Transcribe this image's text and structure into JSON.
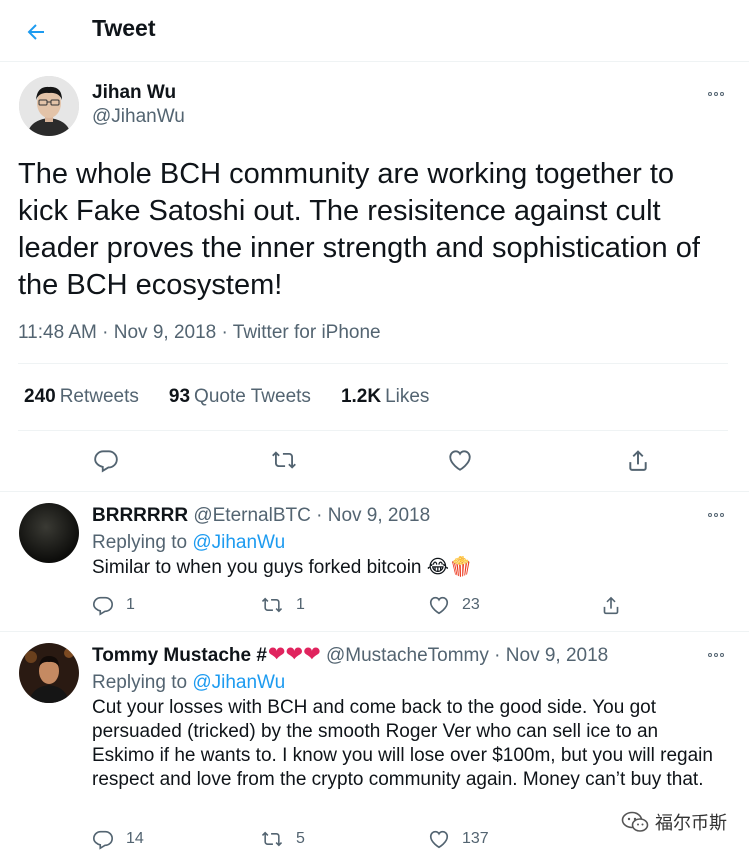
{
  "header": {
    "title": "Tweet"
  },
  "main_tweet": {
    "name": "Jihan Wu",
    "handle": "@JihanWu",
    "text": "The whole BCH community are working together to kick Fake Satoshi out. The resisitence against cult leader proves the inner strength and sophistication of the BCH ecosystem!",
    "time": "11:48 AM",
    "date": "Nov 9, 2018",
    "source": "Twitter for iPhone",
    "sep": "·",
    "retweets_count": "240",
    "retweets_label": "Retweets",
    "quotes_count": "93",
    "quotes_label": "Quote Tweets",
    "likes_count": "1.2K",
    "likes_label": "Likes"
  },
  "replies": [
    {
      "name": "BRRRRRR",
      "handle": "@EternalBTC",
      "sep": "·",
      "date": "Nov 9, 2018",
      "replying_prefix": "Replying to",
      "replying_to": "@JihanWu",
      "text": "Similar to when you guys forked bitcoin",
      "emoji": "😂🍿",
      "reply_count": "1",
      "retweet_count": "1",
      "like_count": "23"
    },
    {
      "name": "Tommy Mustache #",
      "hearts": "❤❤❤",
      "handle": "@MustacheTommy",
      "sep": "·",
      "date": "Nov 9, 2018",
      "replying_prefix": "Replying to",
      "replying_to": "@JihanWu",
      "text": "Cut your losses with BCH and come back to the good side. You got persuaded (tricked) by the smooth Roger Ver who can sell ice to an Eskimo if he wants to.  I know you will lose over $100m, but you will regain respect and love from the crypto community again. Money can’t buy that.",
      "reply_count": "14",
      "retweet_count": "5",
      "like_count": "137"
    }
  ],
  "watermark": {
    "text": "福尔币斯"
  },
  "colors": {
    "accent": "#1d9bf0",
    "text": "#0f1419",
    "muted": "#536471",
    "border": "#eff3f4"
  }
}
